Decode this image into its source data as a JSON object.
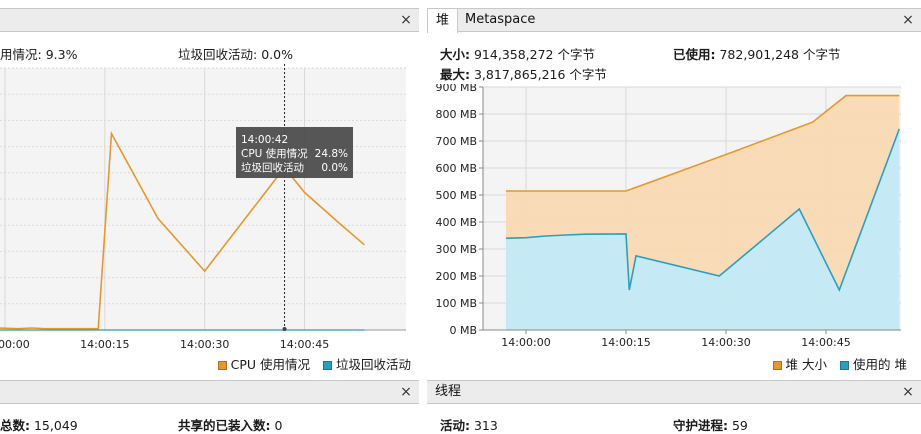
{
  "colors": {
    "orange": "#e8972f",
    "orange_fill": "#f9d9b4",
    "blue": "#2b9ec2",
    "blue_fill": "#c2ebf8",
    "grid": "#d9d9d9",
    "plot_bg": "#f4f4f4",
    "tooltip_bg": "#4d4d4d"
  },
  "cpu_panel": {
    "stat_cpu_label": "用情况:",
    "stat_cpu_value": "9.3%",
    "stat_gc_label": "垃圾回收活动:",
    "stat_gc_value": "0.0%",
    "close_icon": "×",
    "tooltip": {
      "time": "14:00:42",
      "row1_label": "CPU 使用情况",
      "row1_value": "24.8%",
      "row2_label": "垃圾回收活动",
      "row2_value": "0.0%"
    },
    "legend": {
      "cpu": "CPU 使用情况",
      "gc": "垃圾回收活动"
    }
  },
  "heap_panel": {
    "tab_heap": "堆",
    "tab_metaspace": "Metaspace",
    "close_icon": "×",
    "size_label": "大小:",
    "size_value": "914,358,272 个字节",
    "used_label": "已使用:",
    "used_value": "782,901,248 个字节",
    "max_label": "最大:",
    "max_value": "3,817,865,216 个字节",
    "legend": {
      "size": "堆 大小",
      "used": "使用的 堆"
    }
  },
  "bottom_left": {
    "close_icon": "×",
    "total_label": "总数:",
    "total_value": "15,049",
    "shared_label": "共享的已装入数:",
    "shared_value": "0"
  },
  "threads_panel": {
    "title": "线程",
    "close_icon": "×",
    "active_label": "活动:",
    "active_value": "313",
    "daemon_label": "守护进程:",
    "daemon_value": "59"
  },
  "chart_data": [
    {
      "type": "line",
      "x_ticks": [
        "14:00:00",
        "14:00:15",
        "14:00:30",
        "14:00:45"
      ],
      "series": [
        {
          "name": "CPU 使用情况",
          "color": "#e8972f",
          "points": [
            [
              "13:59:59",
              0.3
            ],
            [
              "14:00:02",
              0.2
            ],
            [
              "14:00:04",
              0.3
            ],
            [
              "14:00:06",
              0.2
            ],
            [
              "14:00:10",
              0.2
            ],
            [
              "14:00:14",
              0.2
            ],
            [
              "14:00:15",
              15
            ],
            [
              "14:00:16",
              30
            ],
            [
              "14:00:23",
              17
            ],
            [
              "14:00:30",
              9
            ],
            [
              "14:00:42",
              24.8
            ],
            [
              "14:00:45",
              21
            ],
            [
              "14:00:50",
              16.5
            ],
            [
              "14:00:54",
              13
            ]
          ]
        },
        {
          "name": "垃圾回收活动",
          "color": "#2b9ec2",
          "points": [
            [
              "13:59:59",
              0.0
            ],
            [
              "14:00:54",
              0.0
            ]
          ]
        }
      ],
      "marker": {
        "x": "14:00:42",
        "y": 24.8
      }
    },
    {
      "type": "area",
      "y_ticks": [
        "0 MB",
        "100 MB",
        "200 MB",
        "300 MB",
        "400 MB",
        "500 MB",
        "600 MB",
        "700 MB",
        "800 MB",
        "900 MB"
      ],
      "ylim": [
        0,
        900
      ],
      "x_ticks": [
        "14:00:00",
        "14:00:15",
        "14:00:30",
        "14:00:45"
      ],
      "series": [
        {
          "name": "堆 大小",
          "color": "#e8972f",
          "points": [
            [
              "13:59:57",
              515
            ],
            [
              "14:00:15",
              515
            ],
            [
              "14:00:30",
              650
            ],
            [
              "14:00:43",
              770
            ],
            [
              "14:00:48",
              868
            ],
            [
              "14:00:56",
              868
            ]
          ]
        },
        {
          "name": "使用的 堆",
          "color": "#2b9ec2",
          "points": [
            [
              "13:59:57",
              340
            ],
            [
              "14:00:00",
              342
            ],
            [
              "14:00:03",
              348
            ],
            [
              "14:00:06",
              352
            ],
            [
              "14:00:09",
              355
            ],
            [
              "14:00:15",
              356
            ],
            [
              "14:00:15.5",
              148
            ],
            [
              "14:00:16.5",
              275
            ],
            [
              "14:00:29",
              200
            ],
            [
              "14:00:41",
              448
            ],
            [
              "14:00:47",
              148
            ],
            [
              "14:00:56",
              745
            ]
          ]
        }
      ]
    }
  ]
}
